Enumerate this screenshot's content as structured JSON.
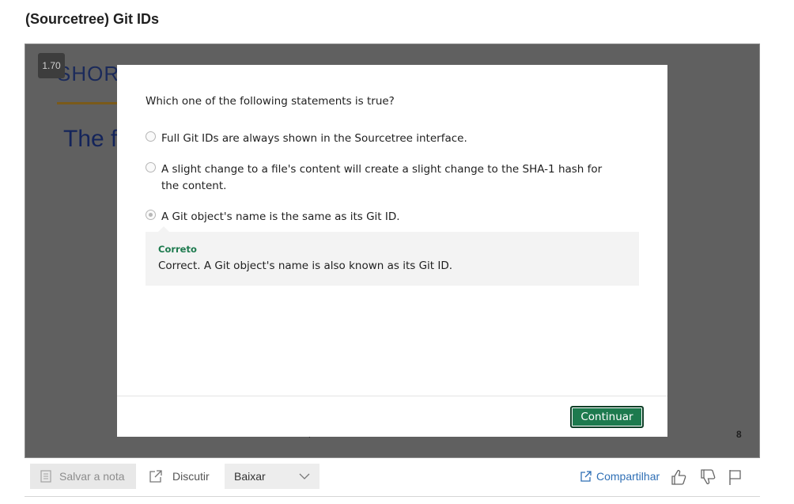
{
  "page": {
    "title": "(Sourcetree) Git IDs"
  },
  "slide": {
    "speed": "1.70",
    "heading": "SHORT",
    "subheading": "The f",
    "page_number": "8",
    "dot": "."
  },
  "quiz": {
    "question": "Which one of the following statements is true?",
    "options": [
      {
        "label": "Full Git IDs are always shown in the Sourcetree interface.",
        "selected": false
      },
      {
        "label": "A slight change to a file's content will create a slight change to the SHA-1 hash for the content.",
        "selected": false
      },
      {
        "label": "A Git object's name is the same as its Git ID.",
        "selected": true
      }
    ],
    "feedback": {
      "title": "Correto",
      "text": "Correct. A Git object's name is also known as its Git ID.",
      "color": "#1d7a4e"
    },
    "continue_label": "Continuar"
  },
  "toolbar": {
    "save_label": "Salvar a nota",
    "discuss_label": "Discutir",
    "download_selected": "Baixar",
    "share_label": "Compartilhar",
    "icons": {
      "save": "note-icon",
      "discuss": "external-link-icon",
      "download": "chevron-down-icon",
      "share": "share-icon",
      "like": "thumbs-up-icon",
      "dislike": "thumbs-down-icon",
      "flag": "flag-icon"
    }
  },
  "colors": {
    "accent_green": "#1d7a4e",
    "link_blue": "#2f6fb5"
  }
}
